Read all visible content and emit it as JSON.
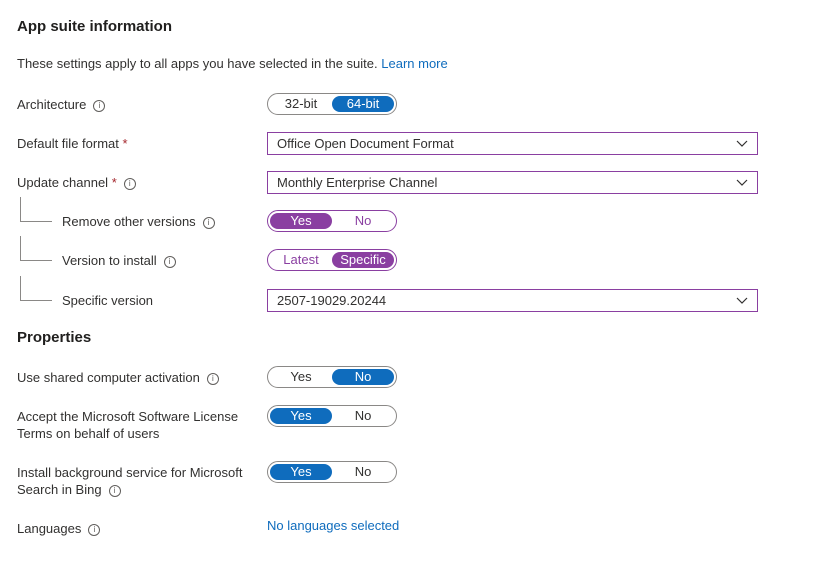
{
  "section1": {
    "title": "App suite information",
    "description": "These settings apply to all apps you have selected in the suite.",
    "learn_more": "Learn more"
  },
  "architecture": {
    "label": "Architecture",
    "options": [
      "32-bit",
      "64-bit"
    ],
    "selected": "64-bit"
  },
  "file_format": {
    "label": "Default file format",
    "required": "*",
    "value": "Office Open Document Format"
  },
  "update_channel": {
    "label": "Update channel",
    "required": "*",
    "value": "Monthly Enterprise Channel"
  },
  "remove_versions": {
    "label": "Remove other versions",
    "options": [
      "Yes",
      "No"
    ],
    "selected": "Yes"
  },
  "version_to_install": {
    "label": "Version to install",
    "options": [
      "Latest",
      "Specific"
    ],
    "selected": "Specific"
  },
  "specific_version": {
    "label": "Specific version",
    "value": "2507-19029.20244"
  },
  "section2": {
    "title": "Properties"
  },
  "shared_activation": {
    "label": "Use shared computer activation",
    "options": [
      "Yes",
      "No"
    ],
    "selected": "No"
  },
  "accept_license": {
    "label_line1": "Accept the Microsoft Software License",
    "label_line2": "Terms on behalf of users",
    "options": [
      "Yes",
      "No"
    ],
    "selected": "Yes"
  },
  "bing_service": {
    "label_line1": "Install background service for Microsoft",
    "label_line2": "Search in Bing",
    "options": [
      "Yes",
      "No"
    ],
    "selected": "Yes"
  },
  "languages": {
    "label": "Languages",
    "value": "No languages selected"
  },
  "icons": {
    "info": "info-icon",
    "dropdown": "chevron-down-icon"
  },
  "colors": {
    "accent_blue": "#0f6cbd",
    "accent_purple": "#8a3fa1",
    "required_red": "#a4262c"
  }
}
